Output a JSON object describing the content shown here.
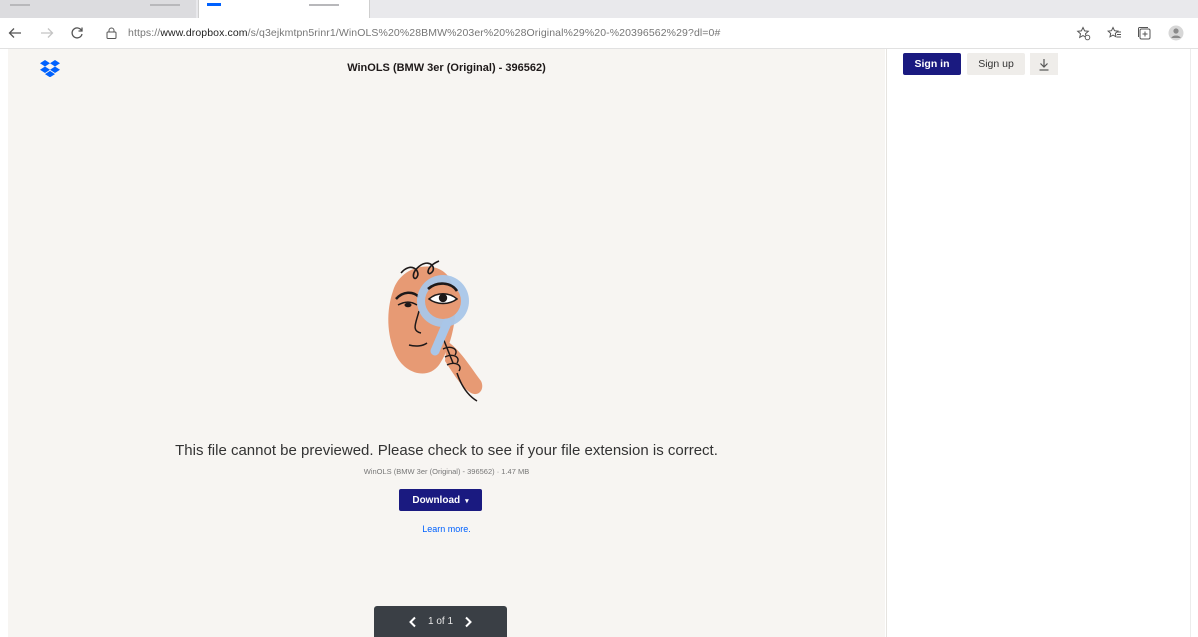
{
  "browser": {
    "url_prefix": "https://",
    "url_host": "www.dropbox.com",
    "url_path": "/s/q3ejkmtpn5rinr1/WinOLS%20%28BMW%203er%20%28Original%29%20-%20396562%29?dl=0#"
  },
  "header": {
    "file_title": "WinOLS (BMW 3er (Original) - 396562)"
  },
  "preview": {
    "message": "This file cannot be previewed. Please check to see if your file extension is correct.",
    "file_meta": "WinOLS (BMW 3er (Original) - 396562) · 1.47 MB",
    "download_label": "Download",
    "learn_more_label": "Learn more."
  },
  "pager": {
    "text": "1 of 1"
  },
  "side_panel": {
    "signin_label": "Sign in",
    "signup_label": "Sign up"
  },
  "colors": {
    "brand_blue": "#0061fe",
    "primary_button": "#1a1a80",
    "preview_bg": "#f7f5f2",
    "pager_bg": "#3a3f45"
  },
  "icons": [
    "back-arrow-icon",
    "forward-arrow-icon",
    "refresh-icon",
    "lock-icon",
    "favorites-add-icon",
    "favorites-icon",
    "collections-icon",
    "profile-icon",
    "dropbox-logo",
    "chevron-left-icon",
    "chevron-right-icon",
    "download-icon"
  ]
}
